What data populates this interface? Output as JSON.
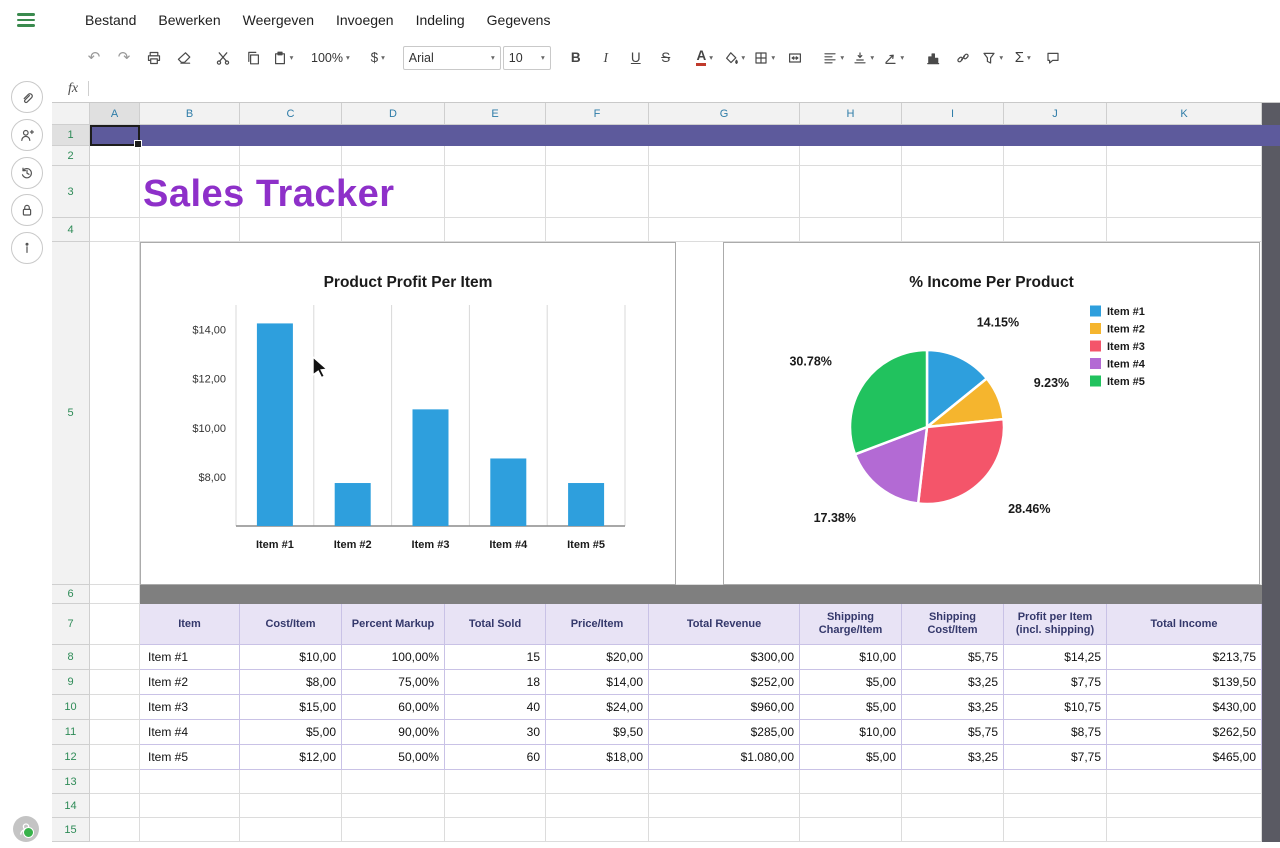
{
  "menu_bar": {
    "items": [
      "Bestand",
      "Bewerken",
      "Weergeven",
      "Invoegen",
      "Indeling",
      "Gegevens"
    ]
  },
  "toolbar": {
    "zoom": "100%",
    "currency": "$",
    "font_name": "Arial",
    "font_size": "10",
    "bold": "B",
    "italic": "I",
    "underline": "U",
    "strikethrough": "S",
    "font_color_letter": "A",
    "sum": "Σ"
  },
  "formula_bar": {
    "fx_label": "fx",
    "value": ""
  },
  "sidebar": {
    "icons": [
      "paperclip",
      "add-user",
      "history",
      "lock",
      "info"
    ]
  },
  "sheet": {
    "title": "Sales Tracker",
    "selected_cell": "A1"
  },
  "grid": {
    "columns": [
      "A",
      "B",
      "C",
      "D",
      "E",
      "F",
      "G",
      "H",
      "I",
      "J",
      "K"
    ],
    "rows": [
      "1",
      "2",
      "3",
      "4",
      "5",
      "6",
      "7",
      "8",
      "9",
      "10",
      "11",
      "12",
      "13",
      "14",
      "15"
    ]
  },
  "table": {
    "headers": [
      "Item",
      "Cost/Item",
      "Percent Markup",
      "Total Sold",
      "Price/Item",
      "Total Revenue",
      "Shipping Charge/Item",
      "Shipping Cost/Item",
      "Profit per Item (incl. shipping)",
      "Total Income"
    ],
    "rows": [
      [
        "Item #1",
        "$10,00",
        "100,00%",
        "15",
        "$20,00",
        "$300,00",
        "$10,00",
        "$5,75",
        "$14,25",
        "$213,75"
      ],
      [
        "Item #2",
        "$8,00",
        "75,00%",
        "18",
        "$14,00",
        "$252,00",
        "$5,00",
        "$3,25",
        "$7,75",
        "$139,50"
      ],
      [
        "Item #3",
        "$15,00",
        "60,00%",
        "40",
        "$24,00",
        "$960,00",
        "$5,00",
        "$3,25",
        "$10,75",
        "$430,00"
      ],
      [
        "Item #4",
        "$5,00",
        "90,00%",
        "30",
        "$9,50",
        "$285,00",
        "$10,00",
        "$5,75",
        "$8,75",
        "$262,50"
      ],
      [
        "Item #5",
        "$12,00",
        "50,00%",
        "60",
        "$18,00",
        "$1.080,00",
        "$5,00",
        "$3,25",
        "$7,75",
        "$465,00"
      ]
    ]
  },
  "theme": {
    "banner_row_fill": "#5d5a9c",
    "gray_band": "#7f7f7f",
    "title_color": "#8e30c9",
    "table_header_fill": "#e8e3f5",
    "table_header_text": "#34386b",
    "accent_green": "#3a8a4e"
  },
  "chart_data": [
    {
      "type": "bar",
      "title": "Product Profit Per Item",
      "categories": [
        "Item #1",
        "Item #2",
        "Item #3",
        "Item #4",
        "Item #5"
      ],
      "values": [
        14.25,
        7.75,
        10.75,
        8.75,
        7.75
      ],
      "xlabel": "",
      "ylabel": "",
      "ylim": [
        6,
        15
      ],
      "yticks": [
        8,
        10,
        12,
        14
      ],
      "ytick_labels": [
        "$8,00",
        "$10,00",
        "$12,00",
        "$14,00"
      ],
      "bar_color": "#2e9fdd",
      "grid": "vertical"
    },
    {
      "type": "pie",
      "title": "% Income Per Product",
      "labels": [
        "Item #1",
        "Item #2",
        "Item #3",
        "Item #4",
        "Item #5"
      ],
      "values": [
        14.15,
        9.23,
        28.46,
        17.38,
        30.78
      ],
      "slice_labels": [
        "14.15%",
        "9.23%",
        "28.46%",
        "17.38%",
        "30.78%"
      ],
      "colors": [
        "#2e9fdd",
        "#f5b52e",
        "#f4556a",
        "#b36ad4",
        "#21c25e"
      ],
      "legend_position": "right",
      "legend_labels": [
        "Item #1",
        "Item #2",
        "Item #3",
        "Item #4",
        "Item #5"
      ]
    }
  ]
}
